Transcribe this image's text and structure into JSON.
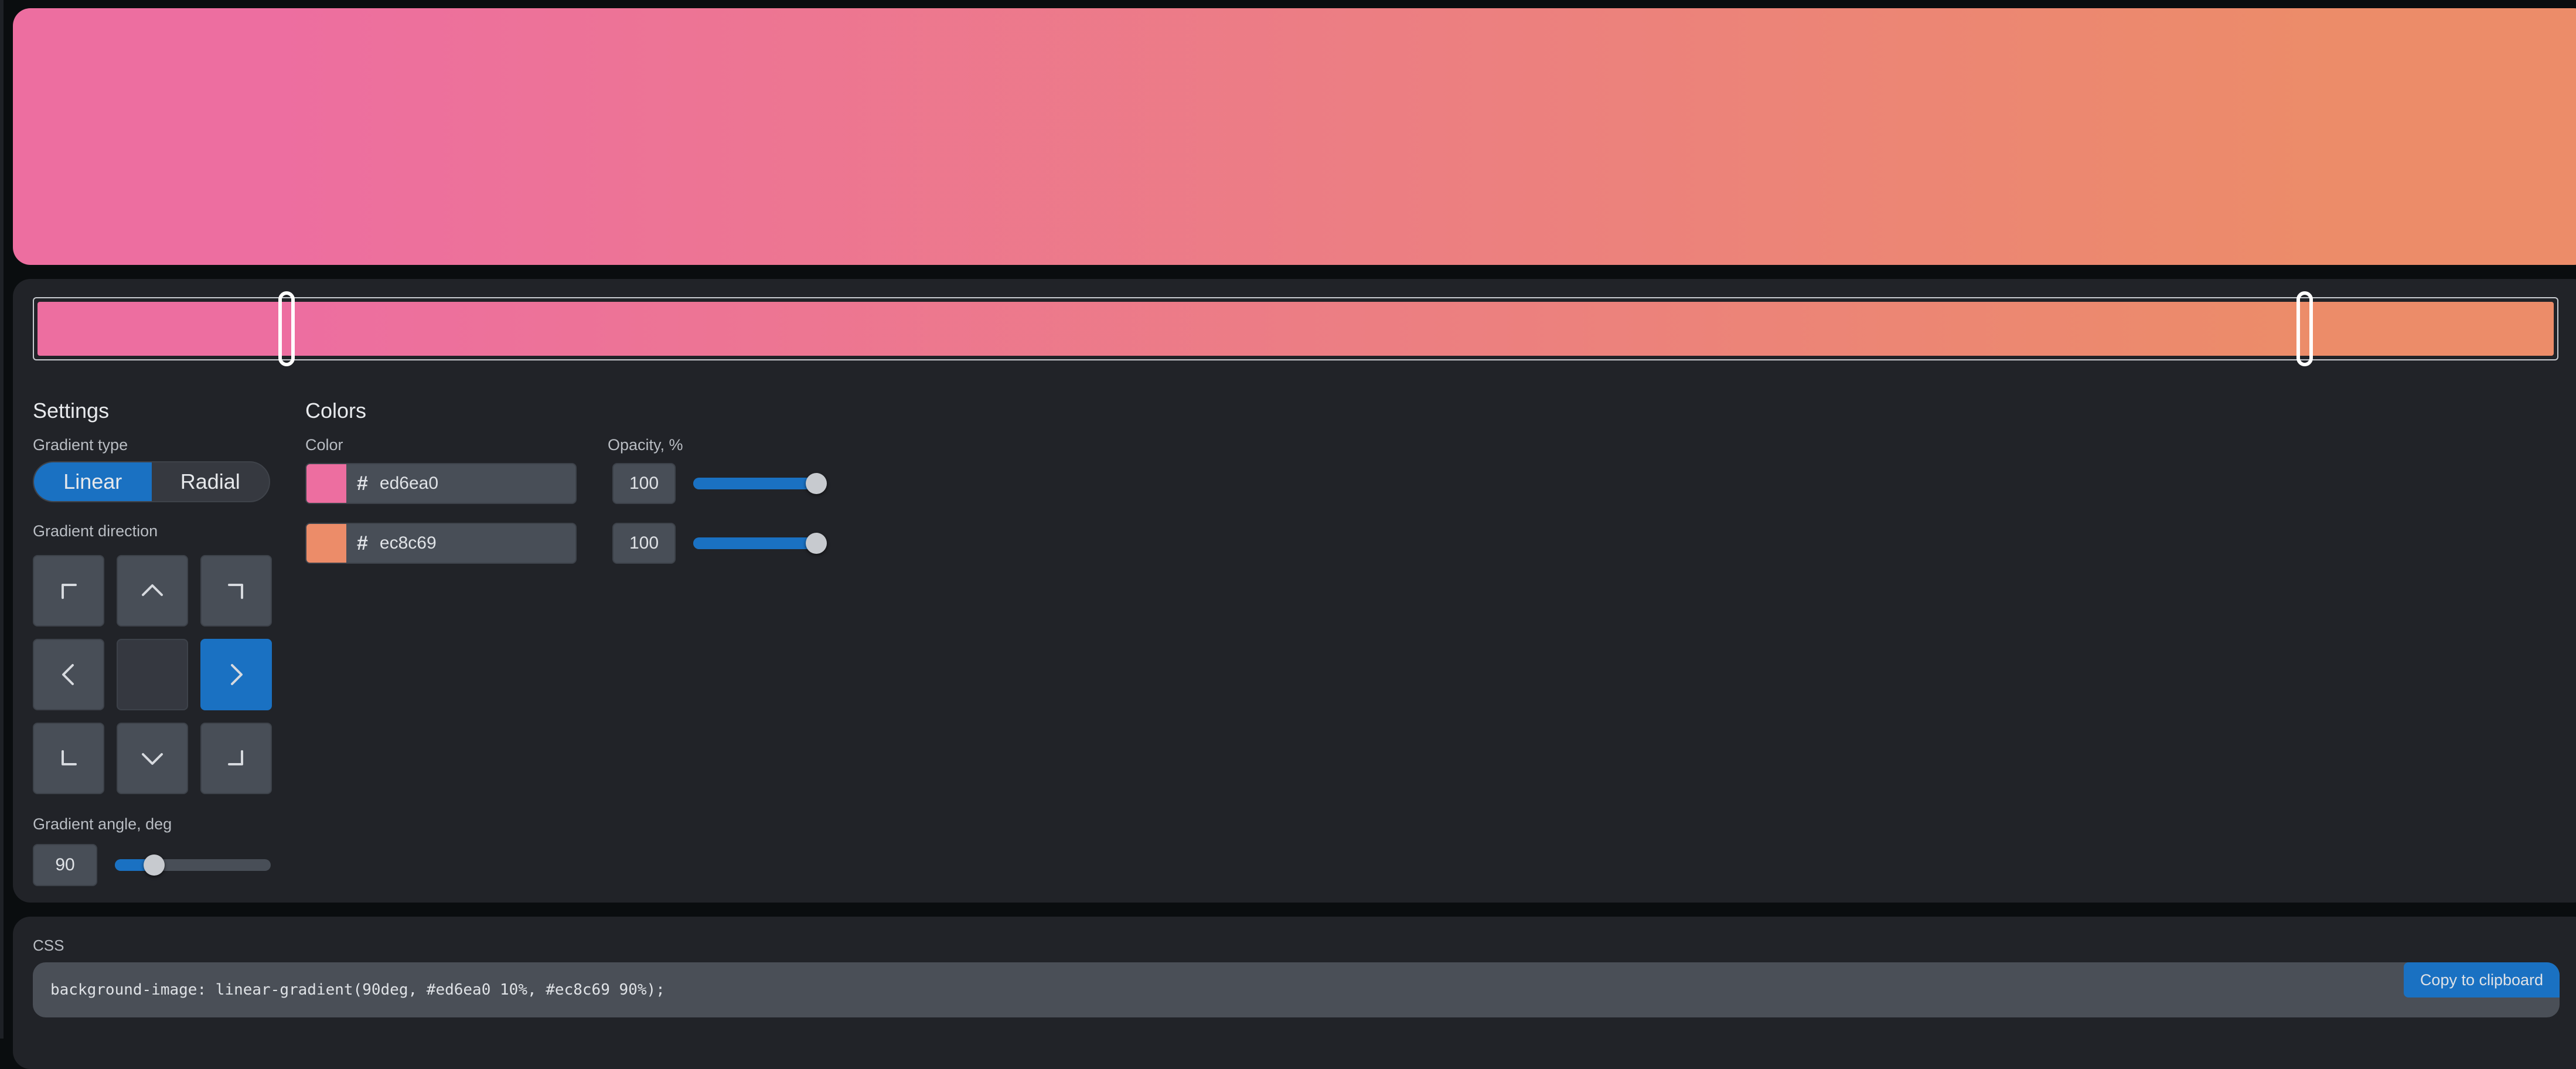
{
  "gradient": {
    "type": "linear",
    "angle_deg": 90,
    "stops": [
      {
        "color": "#ed6ea0",
        "position_percent": 10,
        "opacity_percent": 100
      },
      {
        "color": "#ec8c69",
        "position_percent": 90,
        "opacity_percent": 100
      }
    ]
  },
  "settings": {
    "title": "Settings",
    "gradient_type_label": "Gradient type",
    "type_options": [
      {
        "label": "Linear",
        "active": true
      },
      {
        "label": "Radial",
        "active": false
      }
    ],
    "direction_label": "Gradient direction",
    "directions": [
      {
        "name": "top-left",
        "icon": "corner-top-left-icon",
        "active": false
      },
      {
        "name": "top",
        "icon": "chevron-up-icon",
        "active": false
      },
      {
        "name": "top-right",
        "icon": "corner-top-right-icon",
        "active": false
      },
      {
        "name": "left",
        "icon": "chevron-left-icon",
        "active": false
      },
      {
        "name": "center",
        "icon": "",
        "active": false
      },
      {
        "name": "right",
        "icon": "chevron-right-icon",
        "active": true
      },
      {
        "name": "bottom-left",
        "icon": "corner-bottom-left-icon",
        "active": false
      },
      {
        "name": "bottom",
        "icon": "chevron-down-icon",
        "active": false
      },
      {
        "name": "bottom-right",
        "icon": "corner-bottom-right-icon",
        "active": false
      }
    ],
    "angle_label": "Gradient angle, deg",
    "angle_value": "90",
    "angle_max": 360
  },
  "colors": {
    "title": "Colors",
    "color_label": "Color",
    "opacity_label": "Opacity, %",
    "rows": [
      {
        "hash": "#",
        "hex": "ed6ea0",
        "swatch": "#ed6ea0",
        "opacity": "100",
        "opacity_fraction": 1.0
      },
      {
        "hash": "#",
        "hex": "ec8c69",
        "swatch": "#ec8c69",
        "opacity": "100",
        "opacity_fraction": 1.0
      }
    ]
  },
  "css_output": {
    "label": "CSS",
    "code": "background-image: linear-gradient(90deg, #ed6ea0 10%, #ec8c69 90%);",
    "copy_label": "Copy to clipboard"
  },
  "theme": {
    "accent": "#1a71c2",
    "panel_bg": "#212328",
    "page_bg": "#0a0d0f"
  }
}
